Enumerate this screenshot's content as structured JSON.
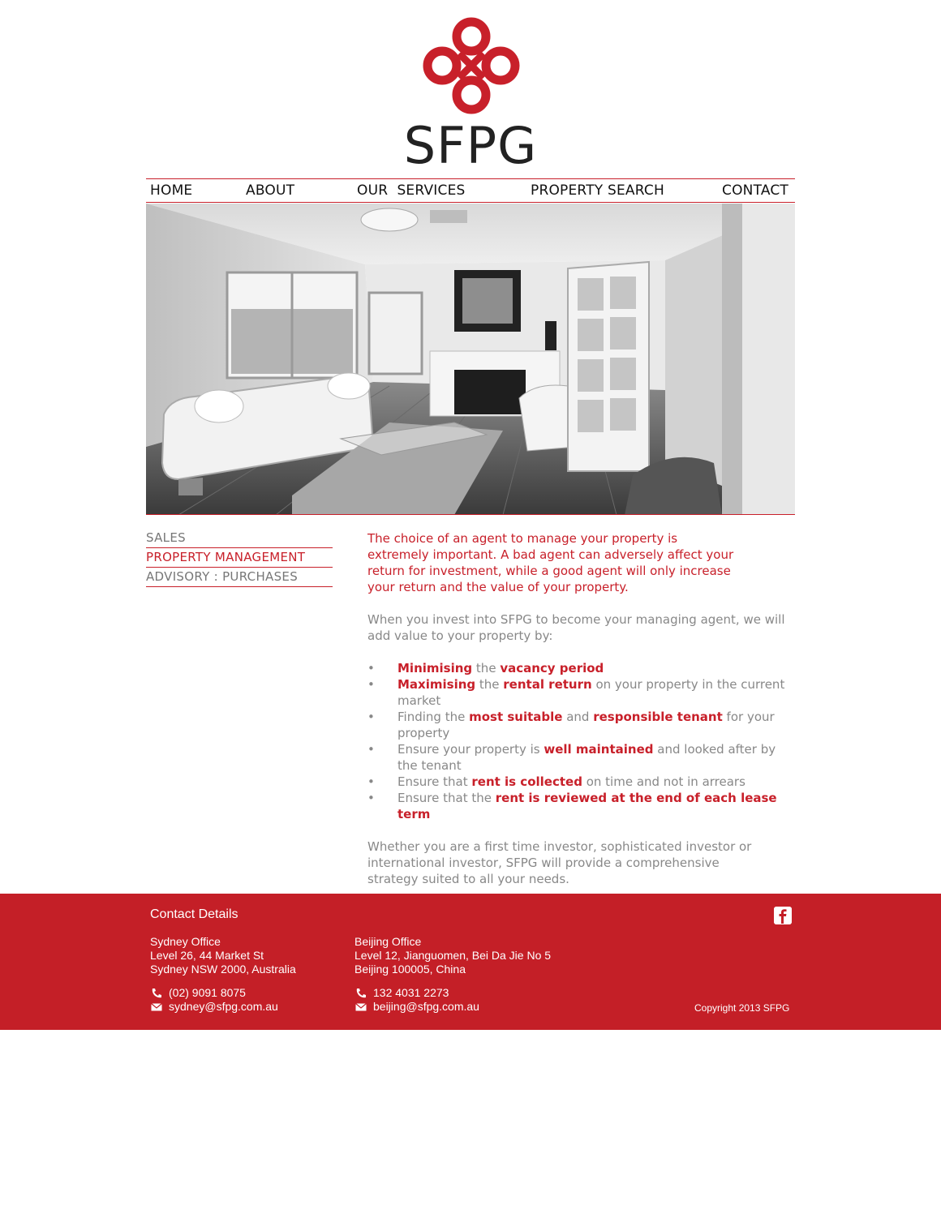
{
  "brand": {
    "name": "SFPG",
    "accent_color": "#c8202a",
    "logo_icon": "endless-knot-logo-icon"
  },
  "nav": {
    "items": [
      {
        "label": "HOME"
      },
      {
        "label": "ABOUT"
      },
      {
        "label": "OUR  SERVICES"
      },
      {
        "label": "PROPERTY SEARCH"
      },
      {
        "label": "CONTACT"
      }
    ]
  },
  "hero": {
    "image": "living-room-photo"
  },
  "sidebar": {
    "items": [
      {
        "label": "SALES",
        "active": false
      },
      {
        "label": "PROPERTY MANAGEMENT",
        "active": true
      },
      {
        "label": "ADVISORY : PURCHASES",
        "active": false
      }
    ]
  },
  "content": {
    "intro": "The choice of an agent to manage your property is extremely important. A bad agent can adversely affect your return for investment, while a good agent will only increase your return and the value of your property.",
    "lead": "When you invest into SFPG to become your managing agent, we will add value to your property by:",
    "bullet_char": "•",
    "benefits": [
      {
        "a": "Minimising",
        "b": " the ",
        "c": "vacancy period",
        "d": "",
        "e": "",
        "f": ""
      },
      {
        "a": "Maximising",
        "b": " the ",
        "c": "rental return",
        "d": " on your property in the current market",
        "e": "",
        "f": ""
      },
      {
        "a": "",
        "b": "Finding the ",
        "c": "most suitable",
        "d": " and ",
        "e": "responsible tenant",
        "f": " for your property"
      },
      {
        "a": "",
        "b": "Ensure your property is ",
        "c": "well maintained",
        "d": " and looked after by the tenant",
        "e": "",
        "f": ""
      },
      {
        "a": "",
        "b": "Ensure that ",
        "c": "rent is collected",
        "d": " on time and not in arrears",
        "e": "",
        "f": ""
      },
      {
        "a": "",
        "b": "Ensure that the ",
        "c": "rent is reviewed at the end of each lease term",
        "d": "",
        "e": "",
        "f": ""
      }
    ],
    "closing": "Whether you are a first time investor, sophisticated investor or international investor, SFPG will provide a comprehensive strategy suited to all your needs."
  },
  "footer": {
    "title": "Contact Details",
    "sydney": {
      "name": "Sydney Office",
      "line1": "Level 26, 44 Market St",
      "line2": "Sydney NSW 2000, Australia",
      "phone": "(02) 9091 8075",
      "email": "sydney@sfpg.com.au"
    },
    "beijing": {
      "name": "Beijing Office",
      "line1": "Level 12, Jianguomen, Bei Da Jie No 5",
      "line2": "Beijing 100005, China",
      "phone": "132 4031 2273",
      "email": "beijing@sfpg.com.au"
    },
    "copyright": "Copyright 2013  SFPG",
    "social_icon": "facebook-icon"
  }
}
